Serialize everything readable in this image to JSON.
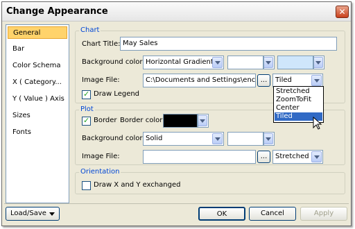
{
  "window": {
    "title": "Change Appearance",
    "close_label": "✕"
  },
  "nav": {
    "items": [
      "General",
      "Bar",
      "Color Schema",
      "X ( Category...",
      "Y ( Value ) Axis",
      "Sizes",
      "Fonts"
    ],
    "selected_index": 0
  },
  "chart": {
    "group_label": "Chart",
    "title_label": "Chart Title:",
    "title_value": "May Sales",
    "bg_label": "Background color:",
    "bg_type": "Horizontal Gradient",
    "bg_color1": "#ffffff",
    "bg_color2": "#cfe6fb",
    "image_label": "Image File:",
    "image_path": "C:\\Documents and Settings\\enc\\De",
    "browse_label": "...",
    "image_mode": "Tiled",
    "draw_legend_label": "Draw Legend",
    "draw_legend_checked": true
  },
  "mode_dropdown": {
    "options": [
      "Stretched",
      "ZoomToFit",
      "Center",
      "Tiled"
    ],
    "selected_index": 3
  },
  "plot": {
    "group_label": "Plot",
    "border_label": "Border",
    "border_checked": true,
    "border_color_label": "Border color:",
    "border_color": "#000000",
    "bg_label": "Background color:",
    "bg_type": "Solid",
    "bg_color": "#ffffff",
    "image_label": "Image File:",
    "image_path": "",
    "browse_label": "...",
    "image_mode": "Stretched"
  },
  "orientation": {
    "group_label": "Orientation",
    "exchange_label": "Draw X and Y exchanged",
    "exchange_checked": false
  },
  "footer": {
    "load_save_label": "Load/Save",
    "ok_label": "OK",
    "cancel_label": "Cancel",
    "apply_label": "Apply"
  }
}
